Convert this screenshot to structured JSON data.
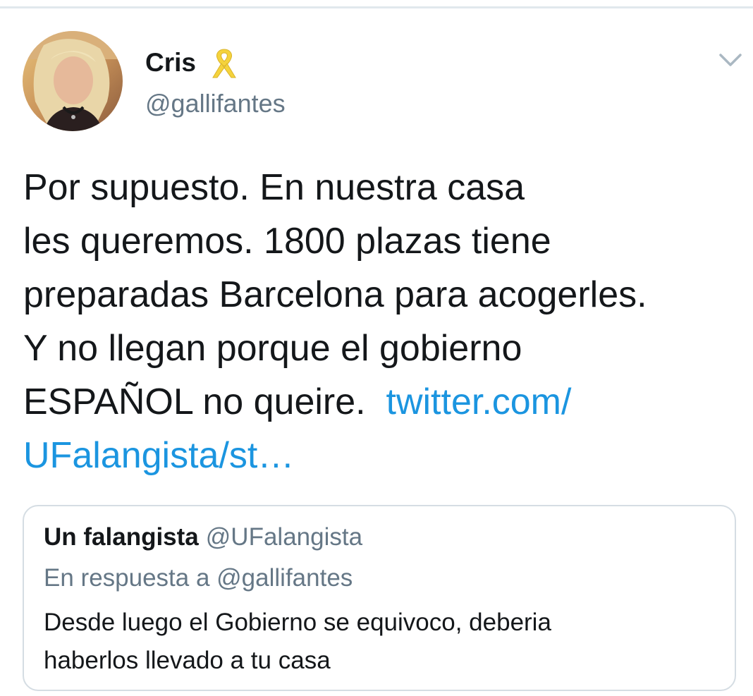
{
  "tweet": {
    "author": {
      "display_name": "Cris",
      "handle": "@gallifantes",
      "badge_icon": "yellow-ribbon-icon",
      "avatar": "profile-photo"
    },
    "menu_icon": "chevron-down-icon",
    "text_lines": [
      "Por supuesto. En nuestra casa",
      "les queremos. 1800 plazas tiene",
      "preparadas Barcelona para acogerles.",
      "Y no llegan porque el gobierno",
      "ESPAÑOL no queire. "
    ],
    "link_line_1": "twitter.com/",
    "link_line_2": "UFalangista/st…"
  },
  "quoted_tweet": {
    "display_name": "Un falangista",
    "handle": "@UFalangista",
    "reply_context": "En respuesta a @gallifantes",
    "text_lines": [
      "Desde luego el Gobierno se equivoco, deberia",
      "haberlos llevado a tu casa"
    ]
  },
  "colors": {
    "text": "#14171a",
    "secondary": "#657786",
    "link": "#1b95e0",
    "ribbon": "#f5d33c",
    "border": "#d5dde3"
  }
}
